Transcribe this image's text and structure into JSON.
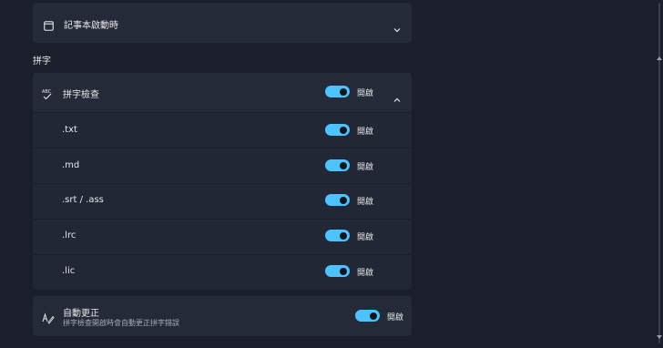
{
  "notepad_startup": {
    "label": "記事本啟動時"
  },
  "section": {
    "title": "拼字"
  },
  "spellcheck": {
    "label": "拼字檢查",
    "icon_text": "ABC",
    "state": "開啟",
    "on": true,
    "file_types": [
      {
        "label": ".txt",
        "state": "開啟",
        "on": true
      },
      {
        "label": ".md",
        "state": "開啟",
        "on": true
      },
      {
        "label": ".srt / .ass",
        "state": "開啟",
        "on": true
      },
      {
        "label": ".lrc",
        "state": "開啟",
        "on": true
      },
      {
        "label": ".lic",
        "state": "開啟",
        "on": true
      }
    ]
  },
  "autocorrect": {
    "label": "自動更正",
    "description": "拼字檢查開啟時會自動更正拼字錯誤",
    "state": "開啟",
    "on": true
  },
  "colors": {
    "accent": "#4cc2ff",
    "background": "#1b1f2b",
    "card": "#252a38"
  }
}
